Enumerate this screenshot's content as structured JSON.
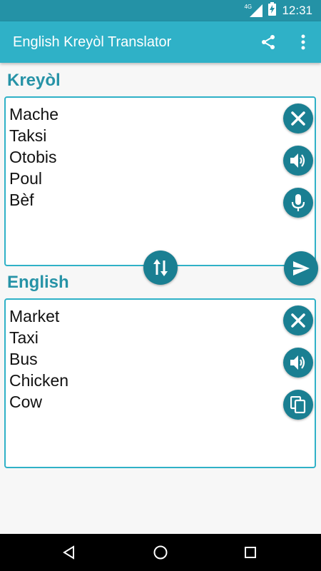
{
  "status_bar": {
    "network": "4G",
    "time": "12:31"
  },
  "app_bar": {
    "title": "English Kreyòl Translator",
    "icons": [
      "share-icon",
      "overflow-menu-icon"
    ]
  },
  "source": {
    "label": "Kreyòl",
    "text": "Mache\nTaksi\nOtobis\nPoul\nBèf",
    "icons": [
      "clear-icon",
      "speaker-icon",
      "microphone-icon"
    ]
  },
  "target": {
    "label": "English",
    "text": "Market\nTaxi\nBus\nChicken\nCow",
    "icons": [
      "clear-icon",
      "speaker-icon",
      "copy-icon"
    ]
  },
  "actions": {
    "swap_icon": "swap-icon",
    "translate_icon": "send-icon"
  },
  "nav_bar": {
    "icons": [
      "back-icon",
      "home-icon",
      "recents-icon"
    ]
  },
  "colors": {
    "status_bar": "#2492a6",
    "app_bar": "#2fb1c7",
    "accent": "#2793a7",
    "button": "#1a7f92"
  }
}
